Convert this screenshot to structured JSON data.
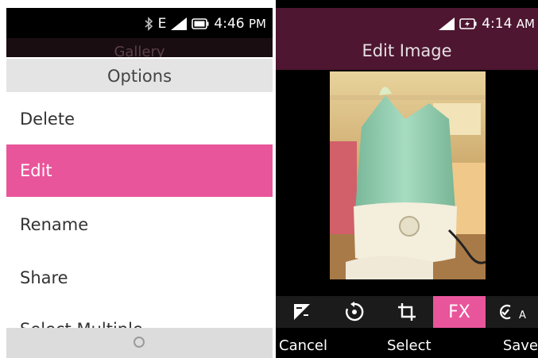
{
  "left": {
    "status": {
      "network": "E",
      "time": "4:46",
      "ampm": "PM"
    },
    "behind_title": "Gallery",
    "options_title": "Options",
    "menu_items": [
      {
        "label": "Delete",
        "selected": false
      },
      {
        "label": "Edit",
        "selected": true
      },
      {
        "label": "Rename",
        "selected": false
      },
      {
        "label": "Share",
        "selected": false
      }
    ],
    "menu_partial": "Select Multiple",
    "home_icon": "circle-home-icon"
  },
  "right": {
    "status": {
      "time": "4:14",
      "ampm": "AM"
    },
    "title": "Edit Image",
    "tools": [
      {
        "icon": "exposure-icon"
      },
      {
        "icon": "rotate-icon"
      },
      {
        "icon": "crop-icon"
      },
      {
        "icon": "fx-icon",
        "label": "FX",
        "active": true
      },
      {
        "icon": "auto-correct-icon",
        "label": "A"
      }
    ],
    "softkeys": {
      "left": "Cancel",
      "center": "Select",
      "right": "Save"
    }
  },
  "colors": {
    "accent": "#e9559a",
    "header": "#4e1631"
  }
}
